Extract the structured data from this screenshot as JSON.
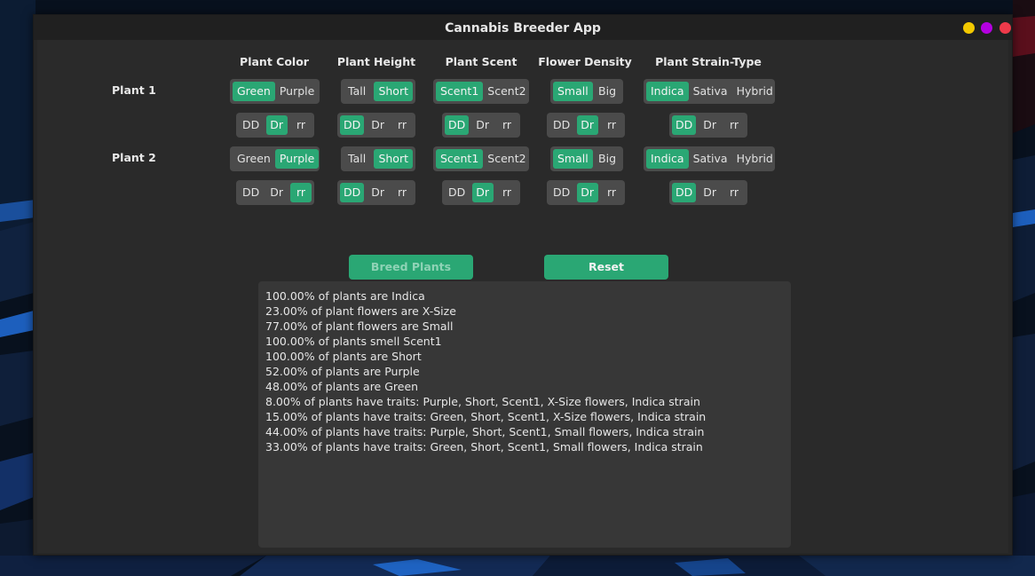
{
  "window": {
    "title": "Cannabis Breeder App",
    "buttons": [
      {
        "name": "minimize-button",
        "color": "#f3c900"
      },
      {
        "name": "maximize-button",
        "color": "#b400e0"
      },
      {
        "name": "close-button",
        "color": "#ef3a4a"
      }
    ]
  },
  "headers": [
    "Plant Color",
    "Plant Height",
    "Plant Scent",
    "Flower Density",
    "Plant Strain-Type"
  ],
  "plants": [
    {
      "label": "Plant 1",
      "traits": [
        {
          "options": [
            "Green",
            "Purple"
          ],
          "selected": 0
        },
        {
          "options": [
            "Tall",
            "Short"
          ],
          "selected": 1
        },
        {
          "options": [
            "Scent1",
            "Scent2"
          ],
          "selected": 0
        },
        {
          "options": [
            "Small",
            "Big"
          ],
          "selected": 0
        },
        {
          "options": [
            "Indica",
            "Sativa",
            "Hybrid"
          ],
          "selected": 0
        }
      ],
      "genes": [
        {
          "options": [
            "DD",
            "Dr",
            "rr"
          ],
          "selected": 1
        },
        {
          "options": [
            "DD",
            "Dr",
            "rr"
          ],
          "selected": 0
        },
        {
          "options": [
            "DD",
            "Dr",
            "rr"
          ],
          "selected": 0
        },
        {
          "options": [
            "DD",
            "Dr",
            "rr"
          ],
          "selected": 1
        },
        {
          "options": [
            "DD",
            "Dr",
            "rr"
          ],
          "selected": 0
        }
      ]
    },
    {
      "label": "Plant 2",
      "traits": [
        {
          "options": [
            "Green",
            "Purple"
          ],
          "selected": 1
        },
        {
          "options": [
            "Tall",
            "Short"
          ],
          "selected": 1
        },
        {
          "options": [
            "Scent1",
            "Scent2"
          ],
          "selected": 0
        },
        {
          "options": [
            "Small",
            "Big"
          ],
          "selected": 0
        },
        {
          "options": [
            "Indica",
            "Sativa",
            "Hybrid"
          ],
          "selected": 0
        }
      ],
      "genes": [
        {
          "options": [
            "DD",
            "Dr",
            "rr"
          ],
          "selected": 2
        },
        {
          "options": [
            "DD",
            "Dr",
            "rr"
          ],
          "selected": 0
        },
        {
          "options": [
            "DD",
            "Dr",
            "rr"
          ],
          "selected": 1
        },
        {
          "options": [
            "DD",
            "Dr",
            "rr"
          ],
          "selected": 1
        },
        {
          "options": [
            "DD",
            "Dr",
            "rr"
          ],
          "selected": 0
        }
      ]
    }
  ],
  "actions": {
    "breed_label": "Breed Plants",
    "reset_label": "Reset"
  },
  "results": [
    "100.00% of plants are Indica",
    "23.00% of plant flowers are X-Size",
    "77.00% of plant flowers are Small",
    "100.00% of plants smell Scent1",
    "100.00% of plants are Short",
    "52.00% of plants are Purple",
    "48.00% of plants are Green",
    "8.00% of plants have traits: Purple, Short, Scent1, X-Size flowers, Indica strain",
    "15.00% of plants have traits: Green, Short, Scent1, X-Size flowers, Indica strain",
    "44.00% of plants have traits: Purple, Short, Scent1, Small flowers, Indica strain",
    "33.00% of plants have traits: Green, Short, Scent1, Small flowers, Indica strain"
  ],
  "colors": {
    "accent": "#2aa774",
    "window_bg": "#2a2a2a",
    "control_bg": "#4b4b4b",
    "results_bg": "#373737"
  }
}
